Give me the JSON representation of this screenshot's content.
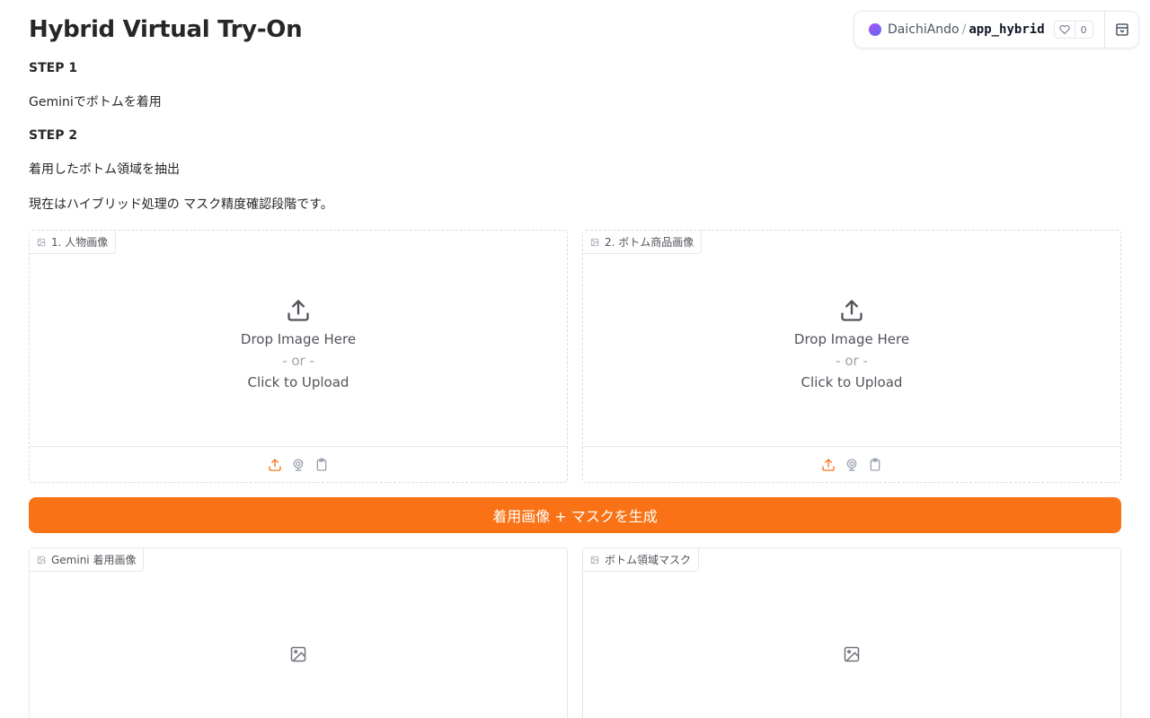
{
  "page": {
    "title": "Hybrid Virtual Try-On"
  },
  "markdown": {
    "step1_heading": "STEP 1",
    "step1_text": "Geminiでボトムを着用",
    "step2_heading": "STEP 2",
    "step2_text": "着用したボトム領域を抽出",
    "note": "現在はハイブリッド処理の マスク精度確認段階です。"
  },
  "space_header": {
    "owner": "DaichiAndo",
    "separator": "/",
    "name": "app_hybrid",
    "likes": "0"
  },
  "inputs": [
    {
      "label": "1. 人物画像",
      "drop_text": "Drop Image Here",
      "or_text": "- or -",
      "click_text": "Click to Upload"
    },
    {
      "label": "2. ボトム商品画像",
      "drop_text": "Drop Image Here",
      "or_text": "- or -",
      "click_text": "Click to Upload"
    }
  ],
  "generate_button": {
    "label": "着用画像 + マスクを生成",
    "color": "#f97316"
  },
  "outputs": [
    {
      "label": "Gemini 着用画像"
    },
    {
      "label": "ボトム領域マスク"
    }
  ],
  "icons": {
    "upload": "upload-icon",
    "webcam": "webcam-icon",
    "clipboard": "clipboard-icon",
    "image": "image-icon",
    "heart": "heart-icon",
    "collapse": "collapse-icon"
  },
  "colors": {
    "accent": "#f97316",
    "text": "#27272a",
    "muted": "#52525b"
  }
}
